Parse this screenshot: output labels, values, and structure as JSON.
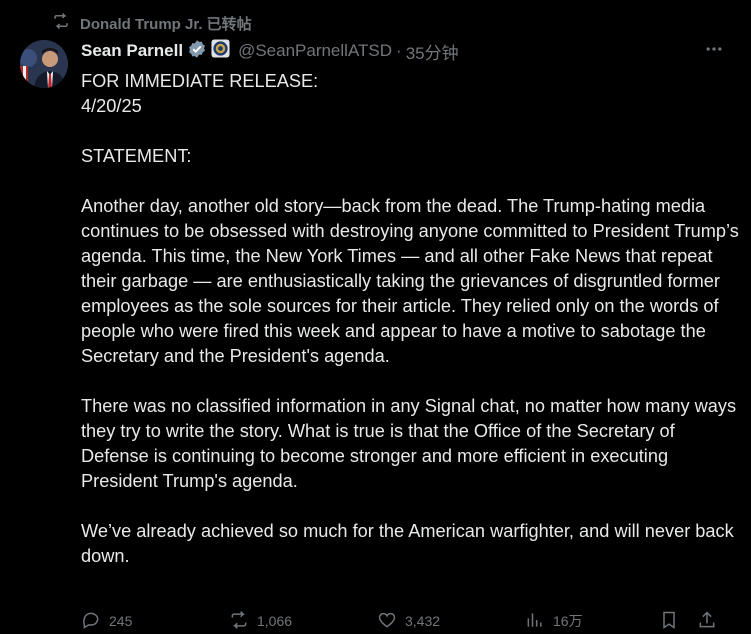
{
  "retweet": {
    "icon": "retweet-icon",
    "label": "Donald Trump Jr. 已转帖"
  },
  "author": {
    "name": "Sean Parnell",
    "handle": "@SeanParnellATSD",
    "separator": "·",
    "time": "35分钟",
    "verified_icon": "verified-badge-icon",
    "affiliate_icon": "affiliate-seal-icon",
    "verified_color": "#829aab"
  },
  "tweet": {
    "paragraphs": [
      "FOR IMMEDIATE RELEASE:\n4/20/25",
      "STATEMENT:",
      "Another day, another old story—back from the dead. The Trump-hating media continues to be obsessed with destroying anyone committed to President Trump’s agenda. This time, the New York Times — and all other Fake News that repeat their garbage — are enthusiastically taking the grievances of disgruntled former employees as the sole sources for their article.  They relied only on the words of people who were fired this week and appear to have a motive to sabotage the Secretary and the President's agenda.",
      "There was no classified information in any Signal chat, no matter how many ways they try to write the story. What is true is that the Office of the Secretary of Defense is continuing to become stronger and more efficient in executing President Trump's agenda.",
      "We’ve already achieved so much for the American warfighter, and will never back down."
    ]
  },
  "actions": {
    "reply": {
      "icon": "reply-icon",
      "count": "245"
    },
    "repost": {
      "icon": "repost-icon",
      "count": "1,066"
    },
    "like": {
      "icon": "heart-icon",
      "count": "3,432"
    },
    "views": {
      "icon": "views-icon",
      "count": "16万"
    },
    "bookmark": {
      "icon": "bookmark-icon"
    },
    "share": {
      "icon": "share-icon"
    }
  },
  "colors": {
    "background": "#000000",
    "text": "#e7e9ea",
    "muted": "#71767b"
  }
}
